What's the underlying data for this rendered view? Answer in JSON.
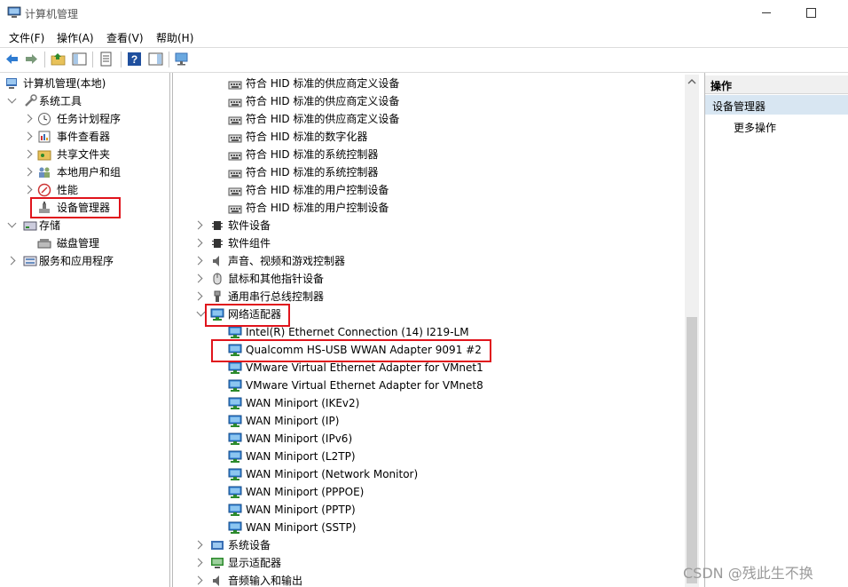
{
  "window": {
    "title": "计算机管理"
  },
  "menubar": [
    "文件(F)",
    "操作(A)",
    "查看(V)",
    "帮助(H)"
  ],
  "left_tree": {
    "root": "计算机管理(本地)",
    "system_tools": "系统工具",
    "task_scheduler": "任务计划程序",
    "event_viewer": "事件查看器",
    "shared_folders": "共享文件夹",
    "local_users": "本地用户和组",
    "performance": "性能",
    "device_manager": "设备管理器",
    "storage": "存储",
    "disk_management": "磁盘管理",
    "services_apps": "服务和应用程序"
  },
  "device_tree": {
    "hid_children": [
      "符合 HID 标准的供应商定义设备",
      "符合 HID 标准的供应商定义设备",
      "符合 HID 标准的供应商定义设备",
      "符合 HID 标准的数字化器",
      "符合 HID 标准的系统控制器",
      "符合 HID 标准的系统控制器",
      "符合 HID 标准的用户控制设备",
      "符合 HID 标准的用户控制设备"
    ],
    "categories_before": [
      "软件设备",
      "软件组件",
      "声音、视频和游戏控制器",
      "鼠标和其他指针设备",
      "通用串行总线控制器"
    ],
    "network_adapters": "网络适配器",
    "network_children": [
      "Intel(R) Ethernet Connection (14) I219-LM",
      "Qualcomm HS-USB WWAN Adapter 9091 #2",
      "VMware Virtual Ethernet Adapter for VMnet1",
      "VMware Virtual Ethernet Adapter for VMnet8",
      "WAN Miniport (IKEv2)",
      "WAN Miniport (IP)",
      "WAN Miniport (IPv6)",
      "WAN Miniport (L2TP)",
      "WAN Miniport (Network Monitor)",
      "WAN Miniport (PPPOE)",
      "WAN Miniport (PPTP)",
      "WAN Miniport (SSTP)"
    ],
    "categories_after": [
      "系统设备",
      "显示适配器",
      "音频输入和输出"
    ]
  },
  "actions": {
    "title": "操作",
    "section": "设备管理器",
    "more": "更多操作"
  },
  "watermark": "CSDN @残此生不换",
  "colors": {
    "highlight_box": "#e0141c",
    "selected_section": "#d8e6f2"
  }
}
